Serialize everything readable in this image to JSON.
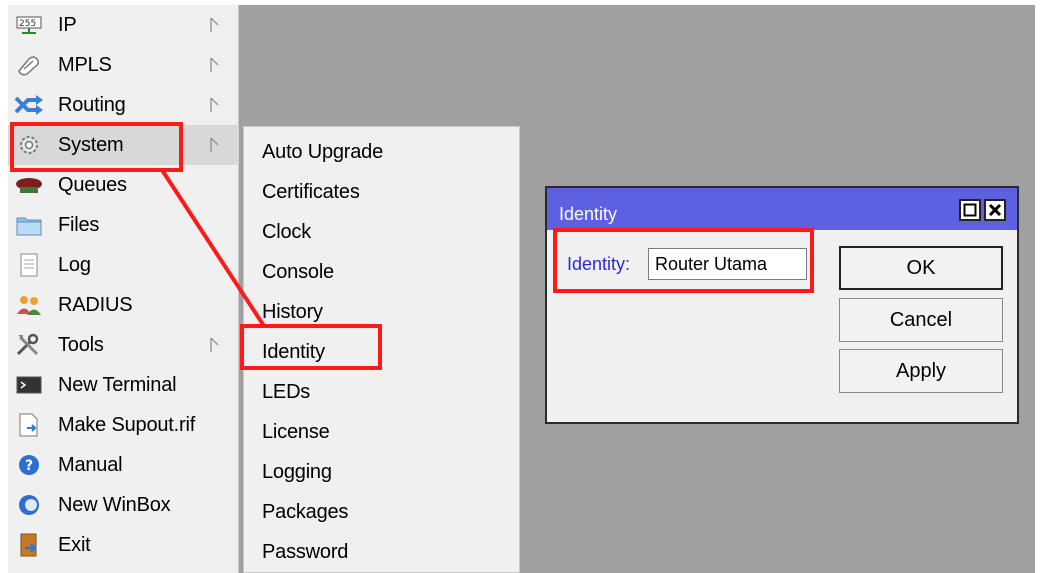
{
  "main_menu": {
    "items": [
      {
        "label": "IP",
        "icon": "ip-icon",
        "has_submenu": true
      },
      {
        "label": "MPLS",
        "icon": "mpls-icon",
        "has_submenu": true
      },
      {
        "label": "Routing",
        "icon": "routing-icon",
        "has_submenu": true
      },
      {
        "label": "System",
        "icon": "gear-icon",
        "has_submenu": true
      },
      {
        "label": "Queues",
        "icon": "queues-icon",
        "has_submenu": false
      },
      {
        "label": "Files",
        "icon": "folder-icon",
        "has_submenu": false
      },
      {
        "label": "Log",
        "icon": "log-icon",
        "has_submenu": false
      },
      {
        "label": "RADIUS",
        "icon": "users-icon",
        "has_submenu": false
      },
      {
        "label": "Tools",
        "icon": "tools-icon",
        "has_submenu": true
      },
      {
        "label": "New Terminal",
        "icon": "terminal-icon",
        "has_submenu": false
      },
      {
        "label": "Make Supout.rif",
        "icon": "document-icon",
        "has_submenu": false
      },
      {
        "label": "Manual",
        "icon": "help-icon",
        "has_submenu": false
      },
      {
        "label": "New WinBox",
        "icon": "winbox-icon",
        "has_submenu": false
      },
      {
        "label": "Exit",
        "icon": "exit-icon",
        "has_submenu": false
      }
    ]
  },
  "system_submenu": {
    "items": [
      "Auto Upgrade",
      "Certificates",
      "Clock",
      "Console",
      "History",
      "Identity",
      "LEDs",
      "License",
      "Logging",
      "Packages",
      "Password"
    ]
  },
  "identity_dialog": {
    "title": "Identity",
    "field_label": "Identity:",
    "field_value": "Router Utama",
    "ok_label": "OK",
    "cancel_label": "Cancel",
    "apply_label": "Apply"
  },
  "colors": {
    "highlight": "#ff1a1a",
    "dialog_title_bg": "#5d60e0",
    "label_blue": "#2b2bd8",
    "workspace_gray": "#a0a0a0"
  }
}
